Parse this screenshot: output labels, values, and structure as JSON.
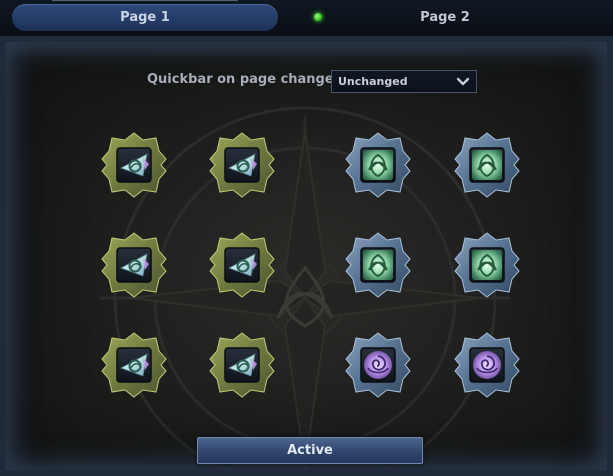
{
  "tabs": [
    {
      "label": "Page 1",
      "active": true
    },
    {
      "label": "Page 2",
      "active": false
    }
  ],
  "status_dot_color": "#39c424",
  "quickbar": {
    "label": "Quickbar on page change",
    "selected": "Unchanged"
  },
  "rune_grid": {
    "rows": [
      [
        {
          "frame": "gold",
          "rune": "white-triangle-rune-icon"
        },
        {
          "frame": "gold",
          "rune": "white-triangle-rune-icon"
        },
        {
          "frame": "blue",
          "rune": "green-celtic-rune-icon"
        },
        {
          "frame": "blue",
          "rune": "green-celtic-rune-icon"
        }
      ],
      [
        {
          "frame": "gold",
          "rune": "white-triangle-rune-icon"
        },
        {
          "frame": "gold",
          "rune": "white-triangle-rune-icon"
        },
        {
          "frame": "blue",
          "rune": "green-celtic-rune-icon"
        },
        {
          "frame": "blue",
          "rune": "green-celtic-rune-icon"
        }
      ],
      [
        {
          "frame": "gold",
          "rune": "white-triangle-rune-icon"
        },
        {
          "frame": "gold",
          "rune": "white-triangle-rune-icon"
        },
        {
          "frame": "blue",
          "rune": "purple-rose-rune-icon"
        },
        {
          "frame": "blue",
          "rune": "purple-rose-rune-icon"
        }
      ]
    ]
  },
  "colors": {
    "gold_frame": "#7f8a4c",
    "blue_frame": "#5f7896",
    "tab_active": "#2a436f",
    "button": "#3a5480"
  },
  "active_button_label": "Active"
}
